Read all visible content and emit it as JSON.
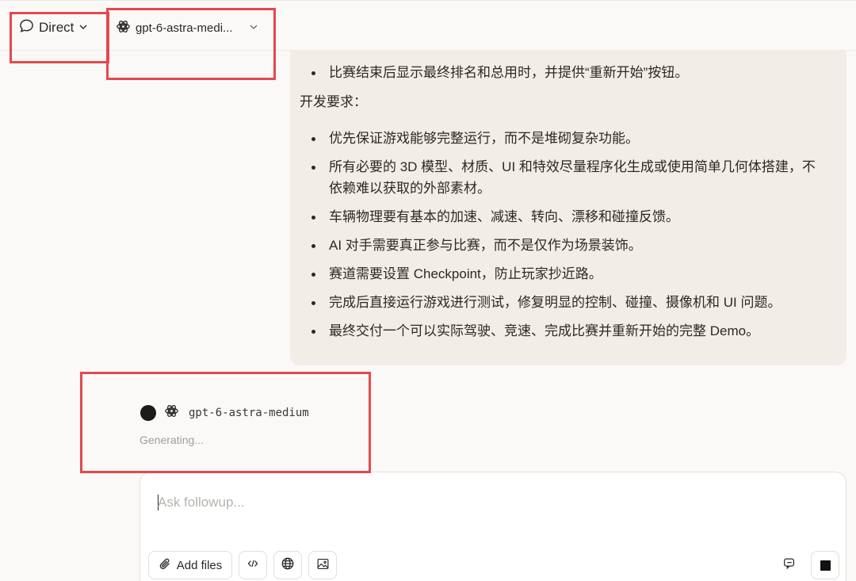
{
  "topbar": {
    "mode_label": "Direct",
    "model_label": "gpt-6-astra-medi..."
  },
  "message": {
    "top_items": [
      "比赛结束后显示最终排名和总用时，并提供“重新开始”按钮。"
    ],
    "section_title": "开发要求：",
    "requirements": [
      "优先保证游戏能够完整运行，而不是堆砌复杂功能。",
      "所有必要的 3D 模型、材质、UI 和特效尽量程序化生成或使用简单几何体搭建，不依赖难以获取的外部素材。",
      "车辆物理要有基本的加速、减速、转向、漂移和碰撞反馈。",
      "AI 对手需要真正参与比赛，而不是仅作为场景装饰。",
      "赛道需要设置 Checkpoint，防止玩家抄近路。",
      "完成后直接运行游戏进行测试，修复明显的控制、碰撞、摄像机和 UI 问题。",
      "最终交付一个可以实际驾驶、竞速、完成比赛并重新开始的完整 Demo。"
    ]
  },
  "response": {
    "model_name": "gpt-6-astra-medium",
    "status": "Generating..."
  },
  "composer": {
    "placeholder": "Ask followup...",
    "add_files_label": "Add files"
  },
  "icons": {
    "mode": "chat-bubble-icon",
    "model": "openai-logo-icon",
    "add_files": "paperclip-icon",
    "code": "code-icon",
    "web": "globe-icon",
    "image": "image-icon",
    "voice": "voice-icon",
    "stop": "stop-icon"
  },
  "colors": {
    "background": "#fbf9f7",
    "bubble": "#f2ede7",
    "highlight": "#e5484d",
    "text": "#2b2926",
    "muted": "#a29d97"
  }
}
